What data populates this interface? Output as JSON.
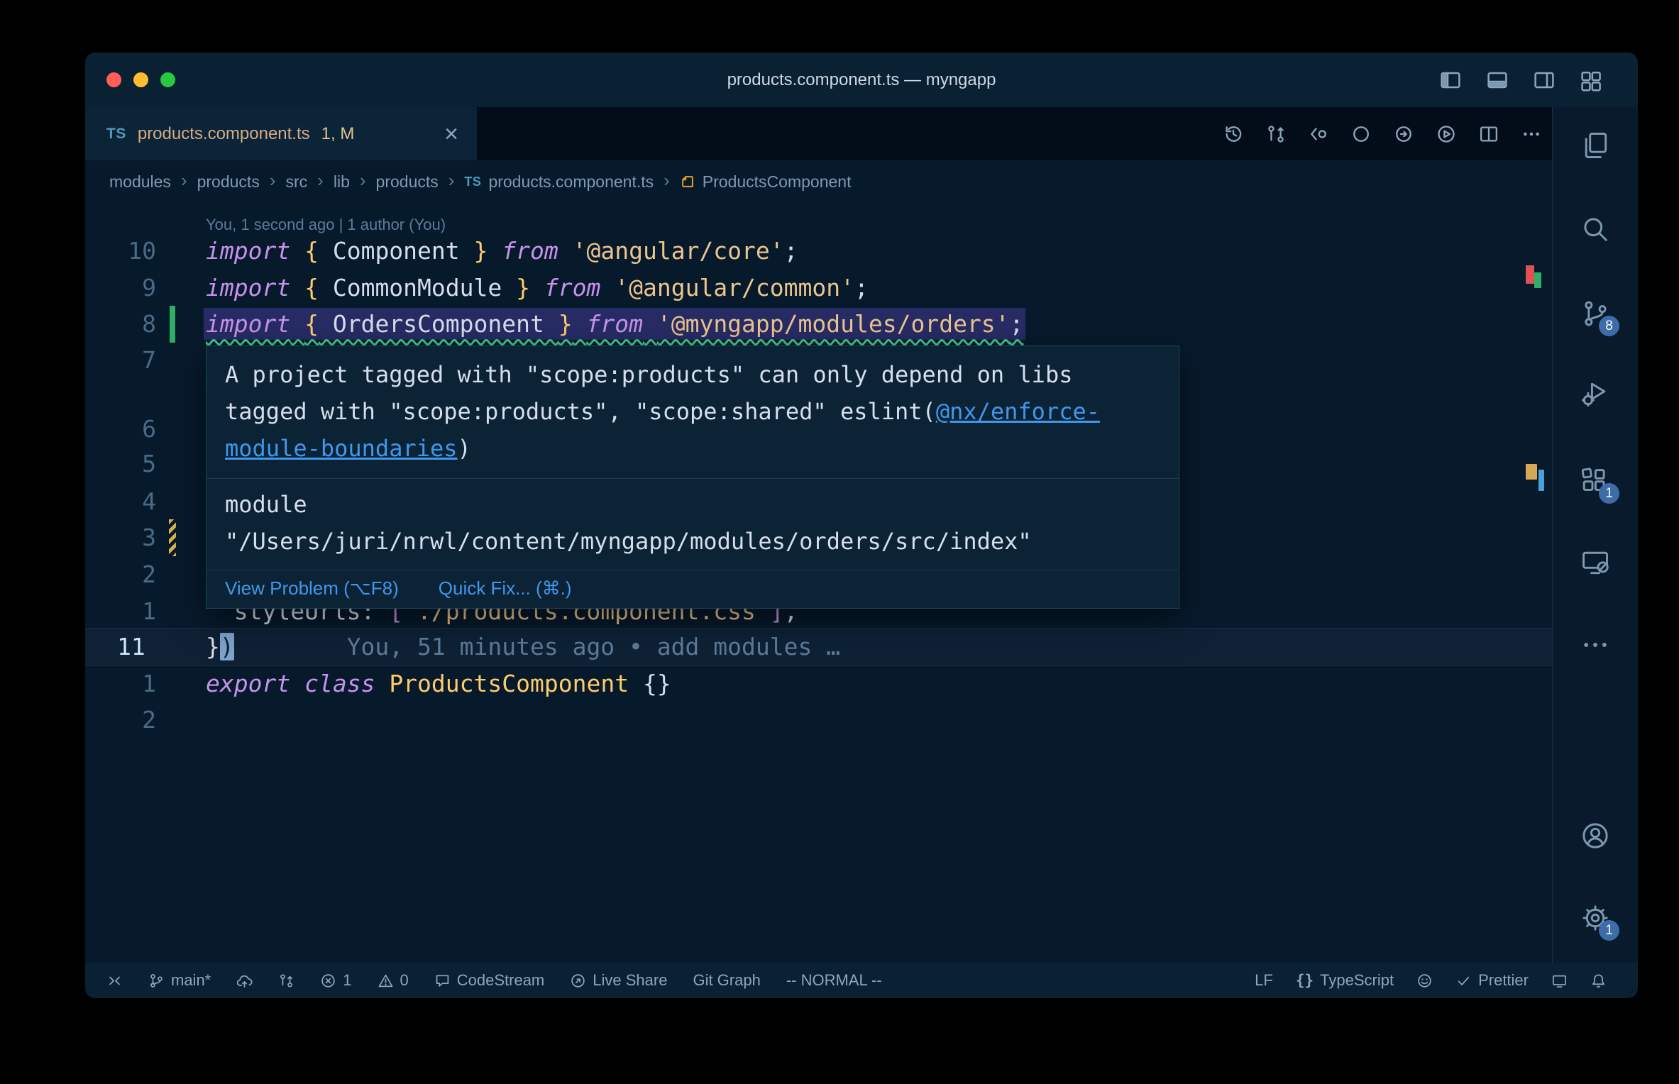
{
  "colors": {
    "link_blue": "#4197ec",
    "error_red": "#e05252",
    "added_green": "#2faf64",
    "modified_yellow": "#dcb14d",
    "badge_blue": "#3d6da8",
    "traffic_red": "#ff5f57",
    "traffic_yellow": "#febc2e",
    "traffic_green": "#28c841",
    "squiggle_green": "#3ecf8e"
  },
  "window": {
    "title": "products.component.ts — myngapp"
  },
  "tab": {
    "type_icon": "TS",
    "label": "products.component.ts",
    "dirty_badge": "1, M",
    "close_glyph": "×"
  },
  "titlebar_icons": [
    "layout-sidebar-left",
    "layout-panel",
    "layout-sidebar-right",
    "layout-editor-grid"
  ],
  "editor_actions": [
    "history",
    "compare-changes",
    "open-changes",
    "previous-change",
    "next-change",
    "run",
    "split-editor",
    "more-actions"
  ],
  "breadcrumb": {
    "separator": "›",
    "folders": [
      "modules",
      "products",
      "src",
      "lib",
      "products"
    ],
    "file": {
      "type_icon": "TS",
      "label": "products.component.ts"
    },
    "symbol": "ProductsComponent"
  },
  "editor": {
    "codelens": "You, 1 second ago | 1 author (You)",
    "lines": [
      {
        "num": "10",
        "tokens": [
          [
            "kw",
            "import"
          ],
          [
            "fg",
            " "
          ],
          [
            "pu",
            "{"
          ],
          [
            "fg",
            " Component "
          ],
          [
            "pu",
            "}"
          ],
          [
            "fg",
            " "
          ],
          [
            "kw",
            "from"
          ],
          [
            "fg",
            " "
          ],
          [
            "st",
            "'@angular/core'"
          ],
          [
            "fg",
            ";"
          ]
        ]
      },
      {
        "num": "9",
        "tokens": [
          [
            "kw",
            "import"
          ],
          [
            "fg",
            " "
          ],
          [
            "pu",
            "{"
          ],
          [
            "fg",
            " CommonModule "
          ],
          [
            "pu",
            "}"
          ],
          [
            "fg",
            " "
          ],
          [
            "kw",
            "from"
          ],
          [
            "fg",
            " "
          ],
          [
            "st",
            "'@angular/common'"
          ],
          [
            "fg",
            ";"
          ]
        ]
      },
      {
        "num": "8",
        "selected": true,
        "squiggle": true,
        "gutter": "added",
        "tokens": [
          [
            "kw",
            "import"
          ],
          [
            "fg",
            " "
          ],
          [
            "pu",
            "{"
          ],
          [
            "fg",
            " OrdersComponent "
          ],
          [
            "pu",
            "}"
          ],
          [
            "fg",
            " "
          ],
          [
            "kw",
            "from"
          ],
          [
            "fg",
            " "
          ],
          [
            "st",
            "'@myngapp/modules/orders'"
          ],
          [
            "fg",
            ";"
          ]
        ]
      },
      {
        "num": "7",
        "tokens": []
      },
      {
        "num": "6",
        "tokens": []
      },
      {
        "num": "5",
        "tokens": []
      },
      {
        "num": "4",
        "tokens": []
      },
      {
        "num": "3",
        "gutter": "modified",
        "tokens": []
      },
      {
        "num": "2",
        "tokens": []
      },
      {
        "num": "1",
        "tokens": [
          [
            "fg",
            "  styleUrls: "
          ],
          [
            "pr",
            "["
          ],
          [
            "st",
            "'./products.component.css'"
          ],
          [
            "pr",
            "]"
          ],
          [
            "fg",
            ","
          ]
        ]
      },
      {
        "num": "11",
        "current": true,
        "tokens": [
          [
            "fg",
            "}"
          ],
          [
            "cursor",
            ")"
          ],
          [
            "bl",
            "        You, 51 minutes ago • add modules …"
          ]
        ]
      },
      {
        "num": "1",
        "tokens": [
          [
            "kw",
            "export"
          ],
          [
            "fg",
            " "
          ],
          [
            "kw",
            "class"
          ],
          [
            "fg",
            " "
          ],
          [
            "cl",
            "ProductsComponent"
          ],
          [
            "fg",
            " "
          ],
          [
            "fg",
            "{}"
          ]
        ]
      },
      {
        "num": "2",
        "tokens": []
      }
    ]
  },
  "hover": {
    "message": "A project tagged with \"scope:products\" can only depend on libs tagged with \"scope:products\", \"scope:shared\" eslint(",
    "rule_link": "@nx/enforce-module-boundaries",
    "message_close": ")",
    "module_label": "module",
    "module_path": "\"/Users/juri/nrwl/content/myngapp/modules/orders/src/index\"",
    "view_problem": "View Problem (⌥F8)",
    "quick_fix": "Quick Fix... (⌘.)"
  },
  "ruler_marks": [
    {
      "color": "#e05252"
    },
    {
      "color": "#2faf64"
    },
    {
      "color": "#d8a657"
    },
    {
      "color": "#4d9fd6"
    }
  ],
  "activity_bar": [
    {
      "name": "explorer"
    },
    {
      "name": "search"
    },
    {
      "name": "source-control",
      "badge": "8"
    },
    {
      "name": "run-and-debug"
    },
    {
      "name": "extensions",
      "badge": "1"
    },
    {
      "name": "remote-explorer"
    },
    {
      "name": "more-actions"
    },
    {
      "name": "accounts"
    },
    {
      "name": "settings",
      "badge": "1"
    }
  ],
  "status_bar": {
    "left": [
      {
        "icon": "remote"
      },
      {
        "icon": "git-branch",
        "label": "main*"
      },
      {
        "icon": "cloud-upload"
      },
      {
        "icon": "git-compare"
      },
      {
        "icon": "error",
        "label": "1"
      },
      {
        "icon": "warning",
        "label": "0"
      },
      {
        "icon": "codestream",
        "label": "CodeStream"
      },
      {
        "icon": "live-share",
        "label": "Live Share"
      },
      {
        "label": "Git Graph"
      },
      {
        "label": "-- NORMAL --"
      }
    ],
    "right": [
      {
        "label": "LF"
      },
      {
        "icon": "braces",
        "glyph": "{}",
        "label": "TypeScript"
      },
      {
        "icon": "smiley"
      },
      {
        "icon": "check",
        "label": "Prettier"
      },
      {
        "icon": "screen"
      },
      {
        "icon": "bell"
      }
    ]
  }
}
